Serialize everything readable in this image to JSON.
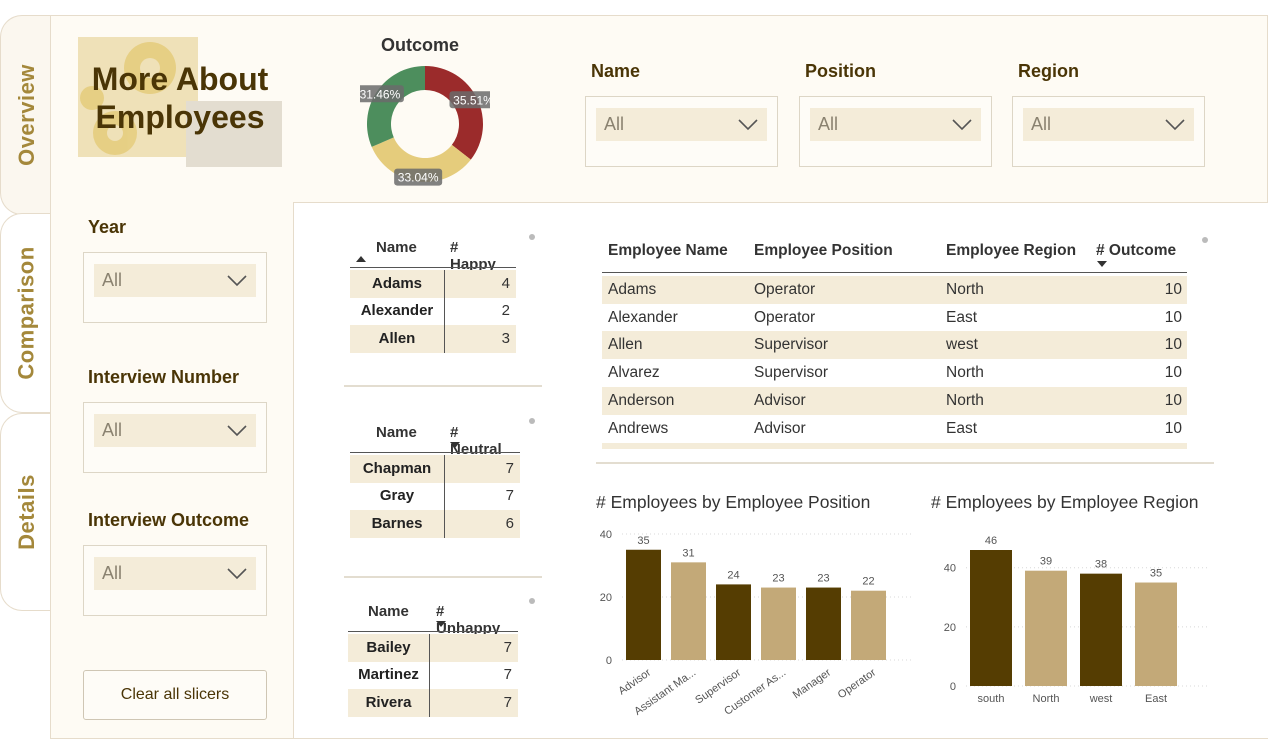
{
  "nav_tabs": [
    {
      "label": "Overview"
    },
    {
      "label": "Comparison"
    },
    {
      "label": "Details"
    }
  ],
  "title": {
    "line1": "More About",
    "line2": "Employees"
  },
  "outcome": {
    "title": "Outcome",
    "slices": [
      {
        "label": "35.51%",
        "value": 35.51,
        "color": "#9b2b2b"
      },
      {
        "label": "33.04%",
        "value": 33.04,
        "color": "#e5cc7c"
      },
      {
        "label": "31.46%",
        "value": 31.46,
        "color": "#4d8e5d"
      }
    ]
  },
  "top_slicers": [
    {
      "label": "Name",
      "value": "All"
    },
    {
      "label": "Position",
      "value": "All"
    },
    {
      "label": "Region",
      "value": "All"
    }
  ],
  "left_slicers": [
    {
      "label": "Year",
      "value": "All"
    },
    {
      "label": "Interview Number",
      "value": "All"
    },
    {
      "label": "Interview Outcome",
      "value": "All"
    }
  ],
  "clear_button": "Clear all slicers",
  "happy_table": {
    "col1": "Name",
    "col2": "# Happy",
    "rows": [
      [
        "Adams",
        "4"
      ],
      [
        "Alexander",
        "2"
      ],
      [
        "Allen",
        "3"
      ]
    ]
  },
  "neutral_table": {
    "col1": "Name",
    "col2": "# Neutral",
    "rows": [
      [
        "Chapman",
        "7"
      ],
      [
        "Gray",
        "7"
      ],
      [
        "Barnes",
        "6"
      ]
    ]
  },
  "unhappy_table": {
    "col1": "Name",
    "col2": "# Unhappy",
    "rows": [
      [
        "Bailey",
        "7"
      ],
      [
        "Martinez",
        "7"
      ],
      [
        "Rivera",
        "7"
      ]
    ]
  },
  "employee_table": {
    "headers": [
      "Employee Name",
      "Employee Position",
      "Employee Region",
      "# Outcome"
    ],
    "rows": [
      [
        "Adams",
        "Operator",
        "North",
        "10"
      ],
      [
        "Alexander",
        "Operator",
        "East",
        "10"
      ],
      [
        "Allen",
        "Supervisor",
        "west",
        "10"
      ],
      [
        "Alvarez",
        "Supervisor",
        "North",
        "10"
      ],
      [
        "Anderson",
        "Advisor",
        "North",
        "10"
      ],
      [
        "Andrews",
        "Advisor",
        "East",
        "10"
      ]
    ]
  },
  "colors": {
    "dark": "#553d02",
    "light": "#c3a978",
    "accent": "#a4883b"
  },
  "chart_data": [
    {
      "type": "bar",
      "title": "# Employees by Employee Position",
      "categories": [
        "Advisor",
        "Assistant Ma...",
        "Supervisor",
        "Customer As...",
        "Manager",
        "Operator"
      ],
      "values": [
        35,
        31,
        24,
        23,
        23,
        22
      ],
      "yticks": [
        "0",
        "20",
        "40"
      ],
      "ylim": [
        0,
        40
      ],
      "grid": true
    },
    {
      "type": "bar",
      "title": "# Employees by Employee Region",
      "categories": [
        "south",
        "North",
        "west",
        "East"
      ],
      "values": [
        46,
        39,
        38,
        35
      ],
      "yticks": [
        "0",
        "20",
        "40"
      ],
      "ylim": [
        0,
        46
      ],
      "grid": true
    }
  ]
}
